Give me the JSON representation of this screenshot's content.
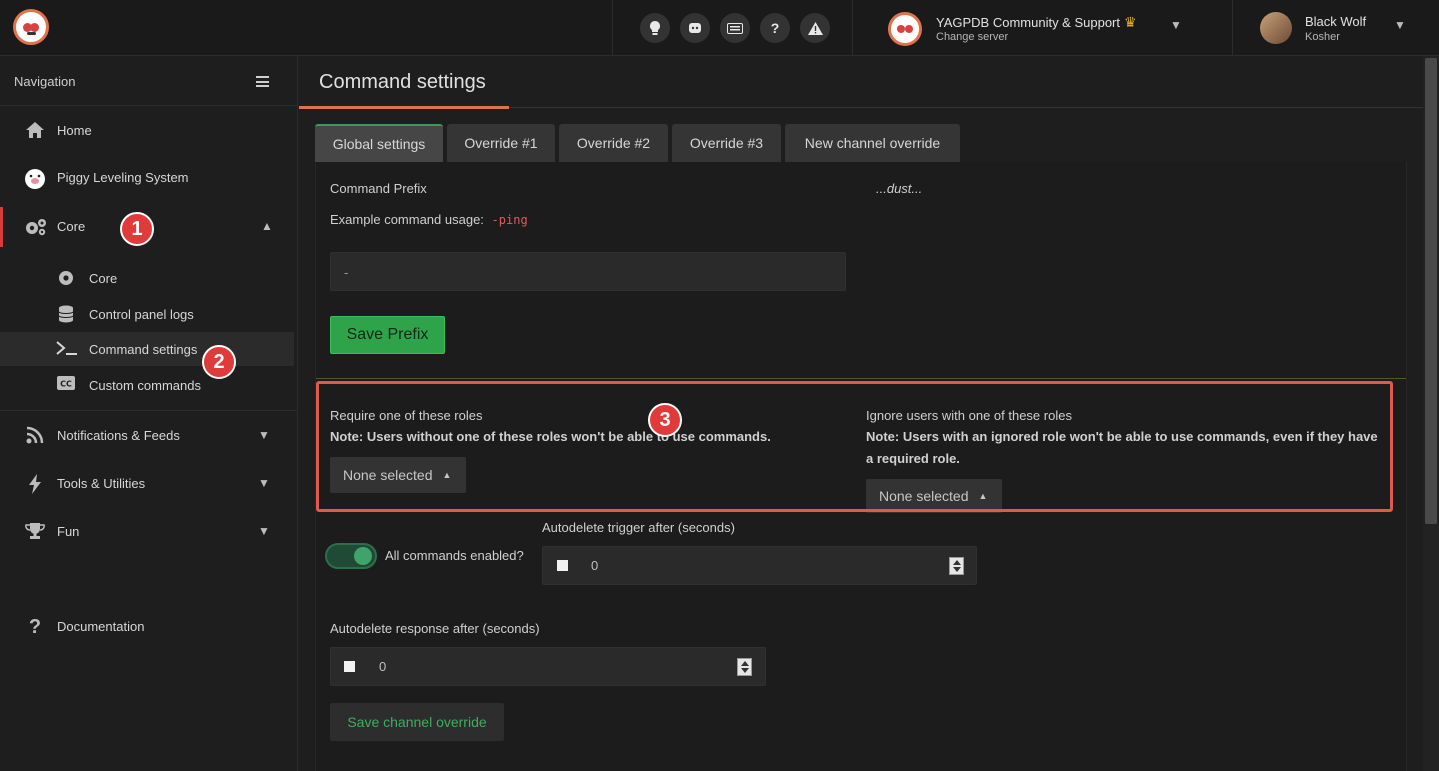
{
  "topbar": {
    "icon_buttons": [
      "lightbulb-icon",
      "discord-icon",
      "keyboard-icon",
      "?",
      "warning-icon"
    ],
    "server": {
      "name": "YAGPDB Community & Support",
      "sub": "Change server",
      "crown": "♛"
    },
    "user": {
      "name": "Black Wolf",
      "sub": "Kosher"
    }
  },
  "sidebar": {
    "heading": "Navigation",
    "items": [
      {
        "label": "Home",
        "icon": "home-icon"
      },
      {
        "label": "Piggy Leveling System",
        "icon": "pig-icon"
      },
      {
        "label": "Core",
        "icon": "gears-icon"
      },
      {
        "label": "Notifications & Feeds",
        "icon": "rss-icon"
      },
      {
        "label": "Tools & Utilities",
        "icon": "bolt-icon"
      },
      {
        "label": "Fun",
        "icon": "trophy-icon"
      },
      {
        "label": "Documentation",
        "icon": "question-icon"
      }
    ],
    "core_sub": [
      {
        "label": "Core",
        "icon": "gear-icon"
      },
      {
        "label": "Control panel logs",
        "icon": "database-icon"
      },
      {
        "label": "Command settings",
        "icon": "terminal-icon"
      },
      {
        "label": "Custom commands",
        "icon": "cc-icon"
      }
    ]
  },
  "annotations": {
    "b1": "1",
    "b2": "2",
    "b3": "3"
  },
  "main": {
    "title": "Command settings",
    "tabs": [
      "Global settings",
      "Override #1",
      "Override #2",
      "Override #3",
      "New channel override"
    ],
    "prefix_label": "Command Prefix",
    "dust": "...dust...",
    "example_label": "Example command usage:",
    "example_code": "-ping",
    "prefix_value": "-",
    "save_prefix": "Save Prefix",
    "require_label": "Require one of these roles",
    "require_note": "Note: Users without one of these roles won't be able to use commands.",
    "ignore_label": "Ignore users with one of these roles",
    "ignore_note": "Note: Users with an ignored role won't be able to use commands, even if they have a required role.",
    "none_selected": "None selected",
    "all_commands": "All commands enabled?",
    "trigger_label": "Autodelete trigger after (seconds)",
    "trigger_value": "0",
    "response_label": "Autodelete response after (seconds)",
    "response_value": "0",
    "save_override": "Save channel override"
  }
}
